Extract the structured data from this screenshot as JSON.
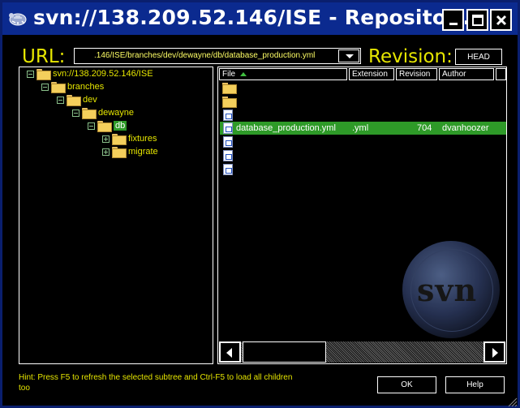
{
  "window": {
    "title": "svn://138.209.52.146/ISE - Repositor…",
    "controls": [
      "minimize-icon",
      "maximize-icon",
      "close-icon"
    ]
  },
  "url_bar": {
    "label": "URL:",
    "value": ".146/ISE/branches/dev/dewayne/db/database_production.yml"
  },
  "revision": {
    "label": "Revision:",
    "button": "HEAD"
  },
  "tree": {
    "items": [
      {
        "label": "svn://138.209.52.146/ISE",
        "expander": "minus"
      },
      {
        "label": "branches",
        "expander": "minus"
      },
      {
        "label": "dev",
        "expander": "minus"
      },
      {
        "label": "dewayne",
        "expander": "minus"
      },
      {
        "label": "db",
        "expander": "minus",
        "selected": true
      },
      {
        "label": "fixtures",
        "expander": "plus"
      },
      {
        "label": "migrate",
        "expander": "plus"
      }
    ]
  },
  "file_list": {
    "columns": [
      "File",
      "Extension",
      "Revision",
      "Author"
    ],
    "sort_column": "File",
    "rows": [
      {
        "icon": "folder-icon",
        "file": "",
        "extension": "",
        "revision": "",
        "author": ""
      },
      {
        "icon": "folder-icon",
        "file": "",
        "extension": "",
        "revision": "",
        "author": ""
      },
      {
        "icon": "file-icon",
        "file": "",
        "extension": "",
        "revision": "",
        "author": ""
      },
      {
        "icon": "file-icon",
        "file": "database_production.yml",
        "extension": ".yml",
        "revision": "704",
        "author": "dvanhoozer",
        "selected": true
      },
      {
        "icon": "file-icon",
        "file": "",
        "extension": "",
        "revision": "",
        "author": ""
      },
      {
        "icon": "file-icon",
        "file": "",
        "extension": "",
        "revision": "",
        "author": ""
      },
      {
        "icon": "file-icon",
        "file": "",
        "extension": "",
        "revision": "",
        "author": ""
      }
    ],
    "watermark": "svn"
  },
  "footer": {
    "hint": "Hint: Press F5 to refresh the selected subtree and Ctrl-F5 to load all children too",
    "ok_label": "OK",
    "help_label": "Help"
  },
  "colors": {
    "accent_yellow": "#e6e600",
    "selection_green": "#2e9a28",
    "titlebar_blue": "#0b2a8f"
  }
}
